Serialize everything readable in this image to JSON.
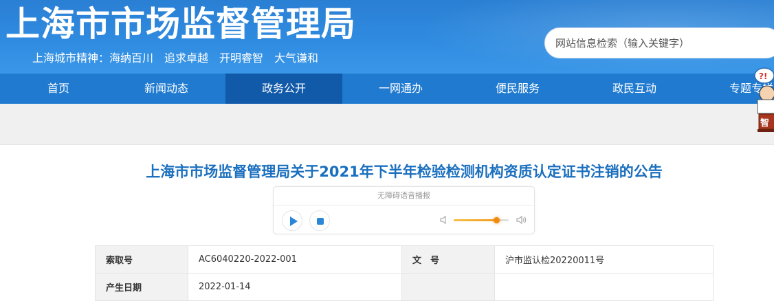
{
  "header": {
    "site_title": "上海市市场监督管理局",
    "motto": "上海城市精神：海纳百川　追求卓越　开明睿智　大气谦和",
    "search_placeholder": "网站信息检索（输入关键字）"
  },
  "nav": {
    "items": [
      {
        "label": "首页"
      },
      {
        "label": "新闻动态"
      },
      {
        "label": "政务公开"
      },
      {
        "label": "一网通办"
      },
      {
        "label": "便民服务"
      },
      {
        "label": "政民互动"
      },
      {
        "label": "专题专栏"
      }
    ],
    "active_index": 2
  },
  "mascot": {
    "bubble_text": "?!",
    "sign_text": "智"
  },
  "article": {
    "title": "上海市市场监督管理局关于2021年下半年检验检测机构资质认定证书注销的公告"
  },
  "player": {
    "label": "无障碍语音播报",
    "play_icon": "play-icon",
    "stop_icon": "stop-icon",
    "volume": 0.78
  },
  "meta": {
    "rows": [
      {
        "k1": "索取号",
        "v1": "AC6040220-2022-001",
        "k2": "文　号",
        "v2": "沪市监认检20220011号"
      },
      {
        "k1": "产生日期",
        "v1": "2022-01-14",
        "k2": "",
        "v2": ""
      }
    ]
  },
  "colors": {
    "header_blue": "#2f8be0",
    "nav_blue": "#1f7ad0",
    "nav_active": "#1159a9",
    "title_blue": "#1a6fbe",
    "volume_orange": "#f08a12"
  }
}
